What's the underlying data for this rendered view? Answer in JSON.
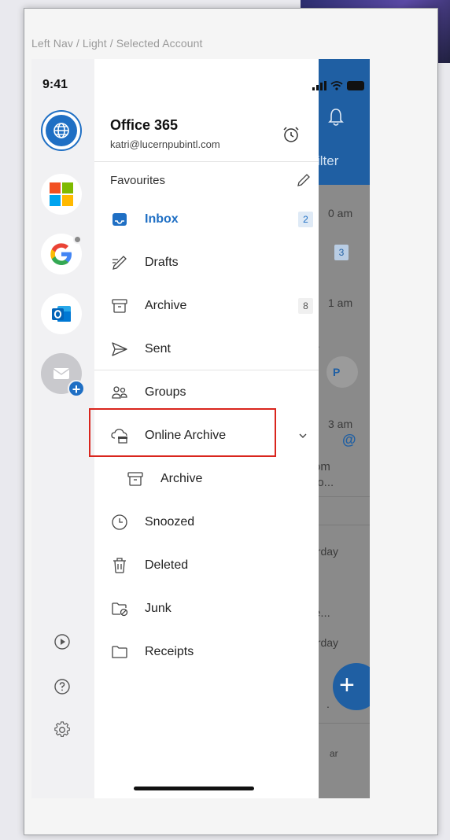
{
  "frame_label": "Left Nav / Light / Selected Account",
  "status_bar": {
    "time": "9:41"
  },
  "account": {
    "name": "Office 365",
    "email": "katri@lucernpubintl.com"
  },
  "favourites_label": "Favourites",
  "folders": [
    {
      "label": "Inbox",
      "icon": "inbox-icon",
      "count": "2",
      "active": true
    },
    {
      "label": "Drafts",
      "icon": "drafts-icon"
    },
    {
      "label": "Archive",
      "icon": "archive-icon",
      "count": "8"
    },
    {
      "label": "Sent",
      "icon": "sent-icon"
    },
    {
      "label": "Groups",
      "icon": "groups-icon"
    },
    {
      "label": "Online Archive",
      "icon": "online-archive-icon",
      "expanded": true,
      "highlighted": true
    },
    {
      "label": "Archive",
      "icon": "archive-icon",
      "sub": true
    },
    {
      "label": "Snoozed",
      "icon": "snoozed-icon"
    },
    {
      "label": "Deleted",
      "icon": "deleted-icon"
    },
    {
      "label": "Junk",
      "icon": "junk-icon"
    },
    {
      "label": "Receipts",
      "icon": "receipts-icon"
    }
  ],
  "background_inbox": {
    "filter_label": "ilter",
    "times": [
      "0 am",
      "1 am",
      "3 am",
      "erday",
      "erday"
    ],
    "badge": "3",
    "avatar_initial": "P",
    "at_symbol": "@",
    "snippets": [
      "...",
      "om",
      "no...",
      "e...",
      "ar",
      "."
    ],
    "fab_icon": "+"
  },
  "colors": {
    "accent": "#1f6fc4",
    "highlight_border": "#d9251d"
  }
}
